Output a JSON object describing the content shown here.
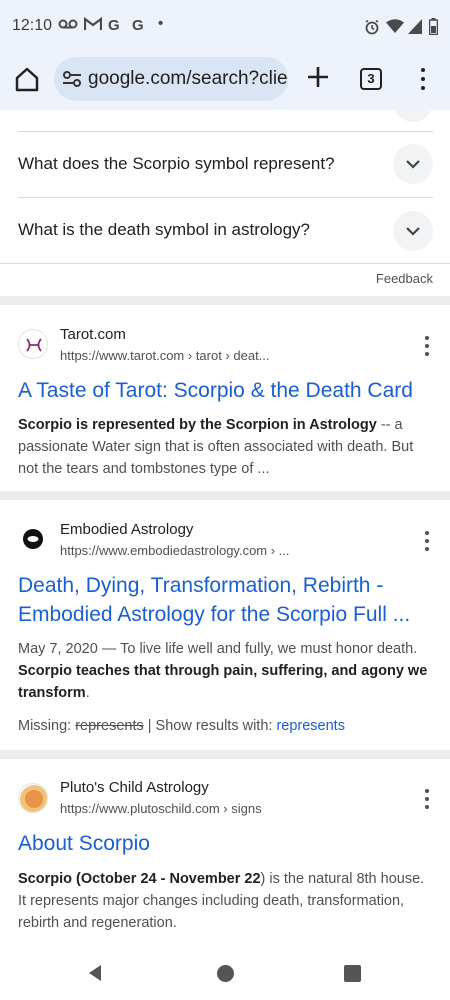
{
  "status": {
    "time": "12:10",
    "left_icons": [
      "voicemail-icon",
      "gmail-icon",
      "google-icon",
      "google-icon",
      "dot-icon"
    ],
    "right_icons": [
      "alarm-icon",
      "wifi-icon",
      "signal-icon",
      "battery-icon"
    ]
  },
  "toolbar": {
    "url": "google.com/search?clier",
    "tab_count": "3"
  },
  "faq": [
    {
      "question": "What does the Scorpio symbol represent?"
    },
    {
      "question": "What is the death symbol in astrology?"
    }
  ],
  "feedback_label": "Feedback",
  "results": [
    {
      "site": "Tarot.com",
      "url": "https://www.tarot.com › tarot › deat...",
      "title": "A Taste of Tarot: Scorpio & the Death Card",
      "snippet_bold": "Scorpio is represented by the Scorpion in Astrology",
      "snippet": " -- a passionate Water sign that is often associated with death. But not the tears and tombstones type of ..."
    },
    {
      "site": "Embodied Astrology",
      "url": "https://www.embodiedastrology.com › ...",
      "title_line1": "Death, Dying, Transformation, Rebirth -",
      "title_line2": "Embodied Astrology for the Scorpio Full ...",
      "date": "May 7, 2020",
      "snippet_a": " — To live life well and fully, we must honor death. ",
      "snippet_bold": "Scorpio teaches that through pain, suffering, and agony we transform",
      "snippet_end": ".",
      "missing_label": "Missing: ",
      "missing_word": "represents",
      "show_label": " | Show results with: ",
      "show_link": "represents"
    },
    {
      "site": "Pluto's Child Astrology",
      "url": "https://www.plutoschild.com › signs",
      "title": "About Scorpio",
      "snippet_bold": "Scorpio (October 24 - November 22",
      "snippet": ") is the natural 8th house. It represents major changes including death, transformation, rebirth and regeneration."
    }
  ],
  "nav": [
    "back-icon",
    "home-icon",
    "recents-icon"
  ]
}
